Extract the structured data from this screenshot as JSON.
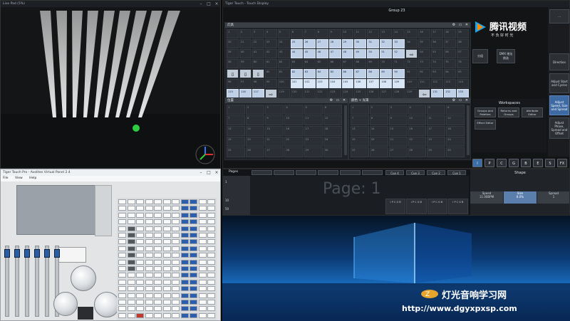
{
  "live_pad": {
    "title": "Live Pad (5%)"
  },
  "touch_display": {
    "title": "Tiger Touch - Touch Display",
    "group_title": "Group 23",
    "fixtures_panel": {
      "title": "灯具"
    },
    "positions_panel": {
      "title": "位置"
    },
    "colours_panel": {
      "title": "颜色 + 光束"
    },
    "side_buttons": [
      "Direction",
      "Adjust Start and Cycles",
      "Adjust Speed, Size and Spread",
      "Adjust Phase, Spread and Offset"
    ],
    "top_buttons": [
      "分组",
      "DMX 地址 挑选"
    ],
    "workspaces_title": "Workspaces",
    "workspace_buttons": [
      "Groups and Palettes",
      "Returns and Groups",
      "Attribute Editor",
      "Effect Editor"
    ],
    "attribute_tabs": [
      "I",
      "P",
      "C",
      "G",
      "B",
      "E",
      "S",
      "FX"
    ],
    "watermark": "腾讯视频",
    "watermark_sub": "不 负 好 时 光"
  },
  "pages": {
    "title": "Pages",
    "page_label": "Page: 1",
    "cue_buttons": [
      "Cue 4",
      "Cue 3",
      "Cue 2",
      "Cue 1"
    ],
    "side_numbers": [
      "1",
      "10",
      "50"
    ],
    "shape_title": "Shape",
    "shape_values": [
      {
        "label": "Speed",
        "value": "11.00BPM"
      },
      {
        "label": "Size",
        "value": "8.0%"
      },
      {
        "label": "Spread",
        "value": "1"
      }
    ]
  },
  "virtual_panel": {
    "title": "Tiger Touch Pro - Avolites Virtual Panel 2.4",
    "menu": [
      "File",
      "View",
      "Help"
    ]
  },
  "footer": {
    "logo_text": "灯光音响学习网",
    "url": "http://www.dgyxpxsp.com"
  },
  "colors": {
    "accent": "#3a6ea5",
    "fixture_bg": "#bfcfe6",
    "desktop_blue": "#1b74c9"
  }
}
